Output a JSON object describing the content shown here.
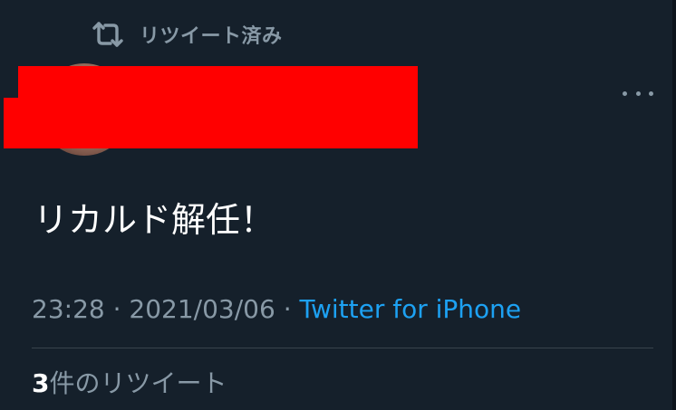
{
  "retweet_banner": {
    "icon": "retweet-icon",
    "label": "リツイート済み"
  },
  "tweet": {
    "text": "リカルド解任！",
    "time": "23:28",
    "separator_1": " · ",
    "date": "2021/03/06",
    "separator_2": " · ",
    "source": "Twitter for iPhone"
  },
  "stats": {
    "retweet_count": "3",
    "retweet_label": "件のリツイート"
  },
  "colors": {
    "background": "#15202b",
    "secondary_text": "#8899a6",
    "link": "#1da1f2",
    "redaction": "#ff0000"
  }
}
